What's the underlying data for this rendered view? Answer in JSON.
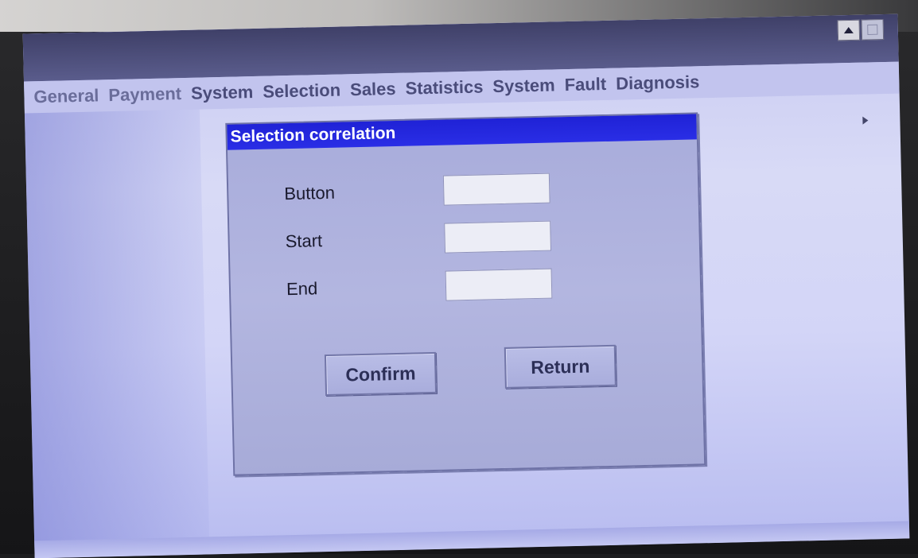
{
  "window": {
    "controls": [
      "up-arrow-icon",
      "blank-box-icon"
    ]
  },
  "menu": {
    "items": [
      {
        "label": "General"
      },
      {
        "label": "Payment"
      },
      {
        "label": "System"
      },
      {
        "label": "Selection"
      },
      {
        "label": "Sales"
      },
      {
        "label": "Statistics"
      },
      {
        "label": "System"
      },
      {
        "label": "Fault"
      },
      {
        "label": "Diagnosis"
      }
    ]
  },
  "dialog": {
    "title": "Selection correlation",
    "fields": [
      {
        "label": "Button",
        "value": ""
      },
      {
        "label": "Start",
        "value": ""
      },
      {
        "label": "End",
        "value": ""
      }
    ],
    "confirm_label": "Confirm",
    "return_label": "Return"
  },
  "colors": {
    "title_bar": "#2a2ee6",
    "screen_bg": "#d3d5f7",
    "dialog_bg": "#b3b6e0",
    "menu_text": "#4a4c7a"
  }
}
